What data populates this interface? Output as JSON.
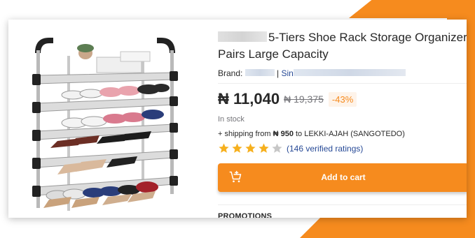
{
  "product": {
    "title_line1": "5-Tiers Shoe Rack Storage Organizer",
    "title_line2": "Pairs Large Capacity",
    "brand_label": "Brand:",
    "brand_separator": "|",
    "brand_link_prefix": "Sin",
    "currency": "₦",
    "price": "₦ 11,040",
    "old_price": "₦ 19,375",
    "discount": "-43%",
    "stock_status": "In stock",
    "shipping_prefix": "+ shipping from",
    "shipping_cost": "₦ 950",
    "shipping_suffix": "to LEKKI-AJAH (SANGOTEDO)",
    "rating": 4,
    "rating_max": 5,
    "ratings_text": "(146 verified ratings)",
    "add_to_cart_label": "Add to cart",
    "promotions_label": "PROMOTIONS"
  },
  "colors": {
    "accent": "#f68b1e",
    "link": "#264996",
    "star_filled": "#f6b01e",
    "star_empty": "#c7c7c7"
  },
  "icons": {
    "cart": "add-to-cart-icon",
    "star": "star-icon"
  }
}
